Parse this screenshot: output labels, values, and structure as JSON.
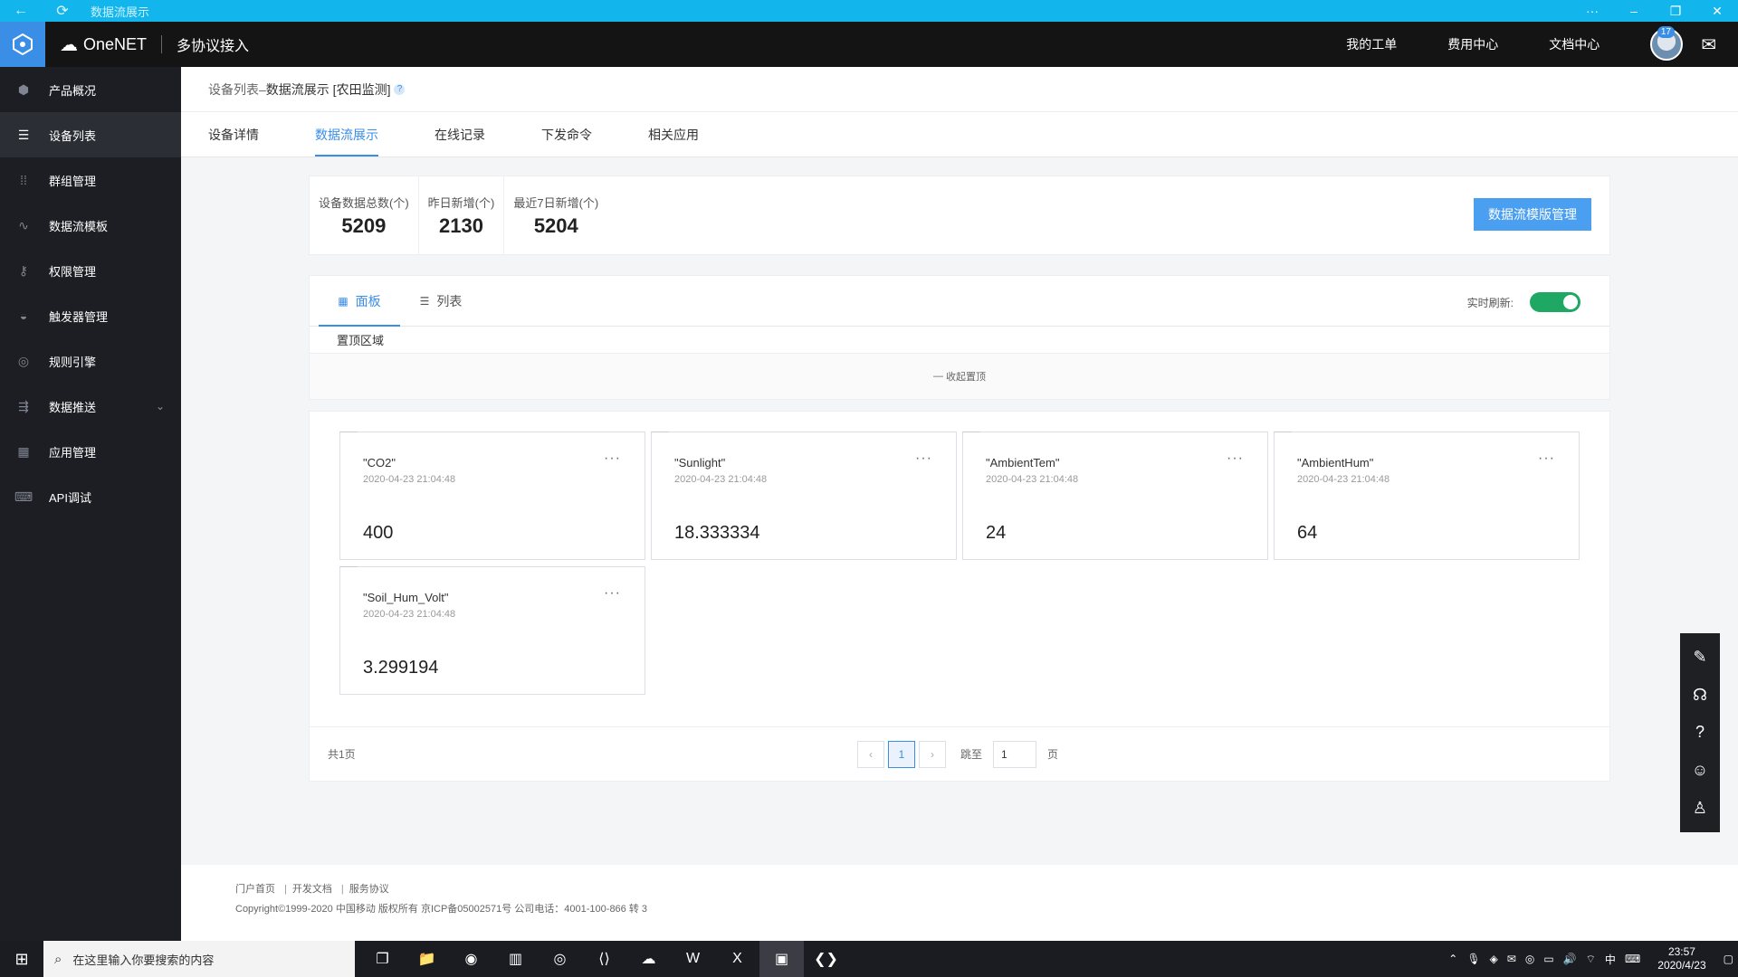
{
  "window": {
    "title": "数据流展示"
  },
  "header": {
    "brand": "OneNET",
    "product": "多协议接入",
    "nav": [
      "我的工单",
      "费用中心",
      "文档中心"
    ],
    "mail_badge": "17"
  },
  "sidebar": {
    "items": [
      {
        "label": "产品概况",
        "icon": "cube-icon"
      },
      {
        "label": "设备列表",
        "icon": "list-icon"
      },
      {
        "label": "群组管理",
        "icon": "grid-dots-icon"
      },
      {
        "label": "数据流模板",
        "icon": "stream-icon"
      },
      {
        "label": "权限管理",
        "icon": "key-icon"
      },
      {
        "label": "触发器管理",
        "icon": "trigger-icon"
      },
      {
        "label": "规则引擎",
        "icon": "rule-icon"
      },
      {
        "label": "数据推送",
        "icon": "push-icon"
      },
      {
        "label": "应用管理",
        "icon": "apps-icon"
      },
      {
        "label": "API调试",
        "icon": "api-icon"
      }
    ]
  },
  "breadcrumb": {
    "parent": "设备列表",
    "sep": " – ",
    "current": "数据流展示 [农田监测]",
    "help": "?"
  },
  "tabs": [
    "设备详情",
    "数据流展示",
    "在线记录",
    "下发命令",
    "相关应用"
  ],
  "stats": [
    {
      "label": "设备数据总数(个)",
      "value": "5209"
    },
    {
      "label": "昨日新增(个)",
      "value": "2130"
    },
    {
      "label": "最近7日新增(个)",
      "value": "5204"
    }
  ],
  "manage_button": "数据流模版管理",
  "view_tabs": [
    "面板",
    "列表"
  ],
  "refresh_label": "实时刷新:",
  "pin_area": "置顶区域",
  "collapse_label": "收起置顶",
  "cards": [
    {
      "name": "\"CO2\"",
      "time": "2020-04-23 21:04:48",
      "value": "400"
    },
    {
      "name": "\"Sunlight\"",
      "time": "2020-04-23 21:04:48",
      "value": "18.333334"
    },
    {
      "name": "\"AmbientTem\"",
      "time": "2020-04-23 21:04:48",
      "value": "24"
    },
    {
      "name": "\"AmbientHum\"",
      "time": "2020-04-23 21:04:48",
      "value": "64"
    },
    {
      "name": "\"Soil_Hum_Volt\"",
      "time": "2020-04-23 21:04:48",
      "value": "3.299194"
    }
  ],
  "card_more": "···",
  "pager": {
    "total": "共1页",
    "current": "1",
    "jump_label": "跳至",
    "jump_value": "1",
    "page_unit": "页"
  },
  "footer": {
    "links": [
      "门户首页",
      "开发文档",
      "服务协议"
    ],
    "copyright": "Copyright©1999-2020 中国移动 版权所有 京ICP备05002571号 公司电话：4001-100-866 转 3"
  },
  "taskbar": {
    "search_placeholder": "在这里输入你要搜索的内容",
    "ime": "中",
    "time": "23:57",
    "date": "2020/4/23"
  }
}
